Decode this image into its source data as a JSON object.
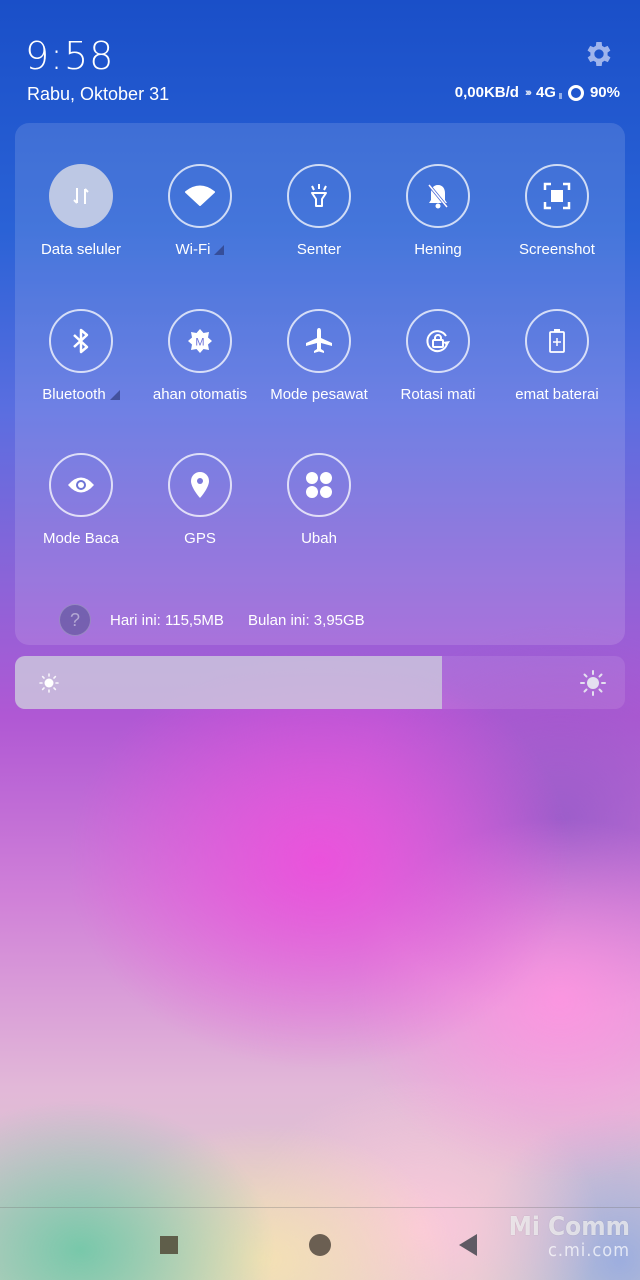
{
  "status": {
    "time": "9:58",
    "date": "Rabu, Oktober 31",
    "net_speed": "0,00KB/d",
    "network_type": "4G",
    "battery": "90%"
  },
  "tiles": [
    {
      "label": "Data seluler",
      "icon": "mobile-data-icon",
      "active": true,
      "has_arrow": false
    },
    {
      "label": "Wi-Fi",
      "icon": "wifi-icon",
      "active": false,
      "has_arrow": true
    },
    {
      "label": "Senter",
      "icon": "flashlight-icon",
      "active": false,
      "has_arrow": false
    },
    {
      "label": "Hening",
      "icon": "silent-bell-icon",
      "active": false,
      "has_arrow": false
    },
    {
      "label": "Screenshot",
      "icon": "screenshot-icon",
      "active": false,
      "has_arrow": false
    },
    {
      "label": "Bluetooth",
      "icon": "bluetooth-icon",
      "active": false,
      "has_arrow": true
    },
    {
      "label": "ahan otomatis",
      "icon": "auto-brightness-icon",
      "active": false,
      "has_arrow": false
    },
    {
      "label": "Mode pesawat",
      "icon": "airplane-icon",
      "active": false,
      "has_arrow": false
    },
    {
      "label": "Rotasi mati",
      "icon": "rotation-lock-icon",
      "active": false,
      "has_arrow": false
    },
    {
      "label": "emat baterai",
      "icon": "battery-saver-icon",
      "active": false,
      "has_arrow": false
    },
    {
      "label": "Mode Baca",
      "icon": "eye-icon",
      "active": false,
      "has_arrow": false
    },
    {
      "label": "GPS",
      "icon": "location-pin-icon",
      "active": false,
      "has_arrow": false
    },
    {
      "label": "Ubah",
      "icon": "grid-edit-icon",
      "active": false,
      "has_arrow": false
    }
  ],
  "usage": {
    "help_glyph": "?",
    "today": "Hari ini: 115,5MB",
    "month": "Bulan ini: 3,95GB"
  },
  "brightness": {
    "level_percent": 70
  },
  "watermark": {
    "line1": "Mi Comm",
    "line2": "c.mi.com"
  },
  "colors": {
    "accent_text": "#ffffff",
    "active_tile": "#d2d7e6"
  }
}
